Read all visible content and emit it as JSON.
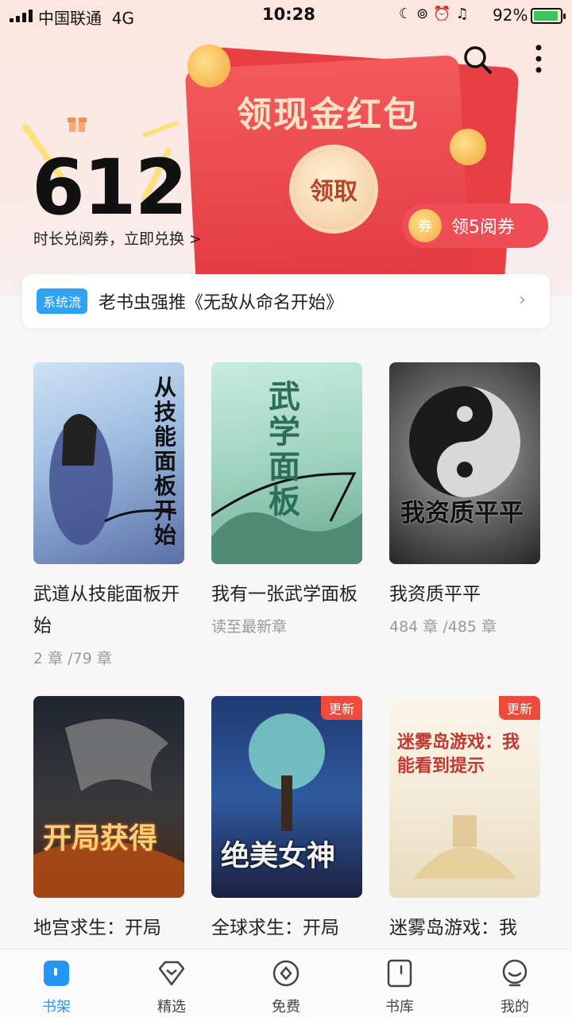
{
  "status_bar": {
    "carrier": "中国联通",
    "network": "4G",
    "time": "10:28",
    "battery": "92%",
    "battery_level": 0.92
  },
  "header": {
    "search_icon": "search-icon",
    "more_icon": "more-vertical-icon"
  },
  "promo": {
    "reading_minutes": "612",
    "exchange_text": "时长兑阅券，立即兑换 >",
    "envelope_title": "领现金红包",
    "claim_label": "领取",
    "coupon_icon_text": "券",
    "coupon_label": "领5阅券"
  },
  "recommend": {
    "tag": "系统流",
    "text": "老书虫强推《无敌从命名开始》",
    "arrow": "›"
  },
  "books": [
    {
      "title": "武道从技能面板开始",
      "progress": "2 章 /79 章",
      "badge": "",
      "cover_text": "从技能面板开始"
    },
    {
      "title": "我有一张武学面板",
      "progress": "读至最新章",
      "badge": "",
      "cover_text": "武学面板"
    },
    {
      "title": "我资质平平",
      "progress": "484 章 /485 章",
      "badge": "",
      "cover_text": "我资质平平"
    },
    {
      "title": "地宫求生：开局",
      "progress": "",
      "badge": "",
      "cover_text": "开局获得"
    },
    {
      "title": "全球求生：开局",
      "progress": "",
      "badge": "更新",
      "cover_text": "绝美女神"
    },
    {
      "title": "迷雾岛游戏：我",
      "progress": "",
      "badge": "更新",
      "cover_text": "迷雾岛游戏：我能看到提示"
    }
  ],
  "tabs": [
    {
      "label": "书架",
      "icon": "bookshelf-icon",
      "active": true
    },
    {
      "label": "精选",
      "icon": "diamond-icon",
      "active": false
    },
    {
      "label": "免费",
      "icon": "free-coin-icon",
      "active": false
    },
    {
      "label": "书库",
      "icon": "library-icon",
      "active": false
    },
    {
      "label": "我的",
      "icon": "profile-face-icon",
      "active": false
    }
  ],
  "colors": {
    "accent": "#2596f5",
    "red": "#ef4d55",
    "tag_blue": "#2fa3f3"
  }
}
